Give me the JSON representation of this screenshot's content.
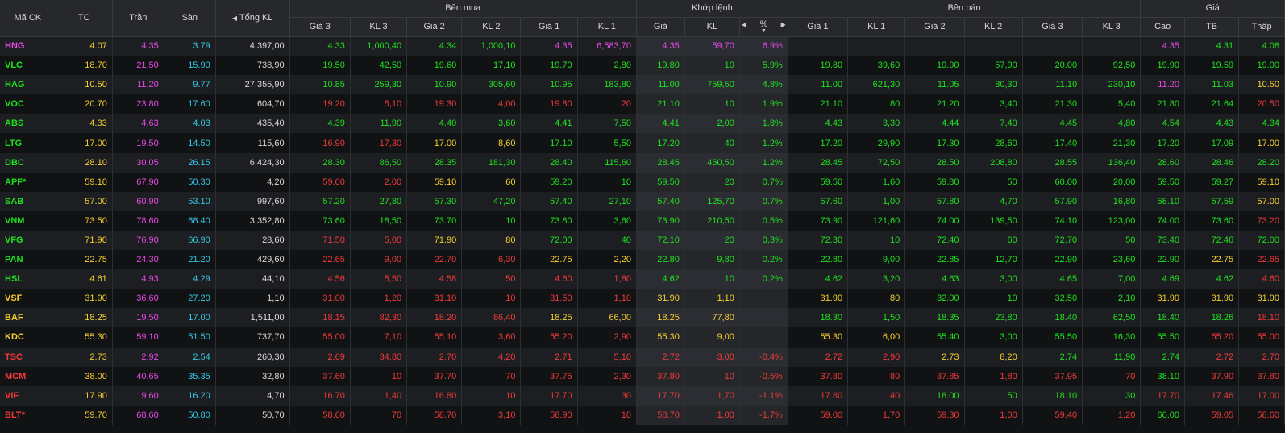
{
  "header": {
    "symbol": "Mã CK",
    "ref": "TC",
    "ceil": "Trần",
    "floor": "Sàn",
    "total": "Tổng KL",
    "buy_group": "Bên mua",
    "match_group": "Khớp lệnh",
    "sell_group": "Bên bán",
    "price_group": "Giá",
    "buy_cols": [
      "Giá 3",
      "KL 3",
      "Giá 2",
      "KL 2",
      "Giá 1",
      "KL 1"
    ],
    "match_cols": [
      "Giá",
      "KL",
      "%"
    ],
    "sell_cols": [
      "Giá 1",
      "KL 1",
      "Giá 2",
      "KL 2",
      "Giá 3",
      "KL 3"
    ],
    "price_cols": [
      "Cao",
      "TB",
      "Thấp"
    ],
    "arrow_left": "◀",
    "arrow_right": "▶",
    "sort_down": "▼"
  },
  "colors": {
    "up": "#1ee21e",
    "down": "#f23a3a",
    "ref": "#f5d030",
    "ceil": "#e44ae8",
    "floor": "#33c9e8",
    "neutral": "#d9d9d9"
  },
  "rows": [
    {
      "sym": "HNG",
      "sc": "ceil",
      "ref": "4.07",
      "ceil": "4.35",
      "floor": "3.79",
      "total": "4,397,00",
      "b3": [
        "4.33",
        "1,000,40",
        "up"
      ],
      "b2": [
        "4.34",
        "1,000,10",
        "up"
      ],
      "b1": [
        "4.35",
        "6,583,70",
        "ceil"
      ],
      "mp": [
        "4.35",
        "ceil"
      ],
      "mv": "59,70",
      "mpct": "6.9%",
      "s1": [
        "",
        "",
        ""
      ],
      "s2": [
        "",
        "",
        ""
      ],
      "s3": [
        "",
        "",
        ""
      ],
      "hi": [
        "4.35",
        "ceil"
      ],
      "avg": [
        "4.31",
        "up"
      ],
      "lo": [
        "4.08",
        "up"
      ]
    },
    {
      "sym": "VLC",
      "sc": "up",
      "ref": "18.70",
      "ceil": "21.50",
      "floor": "15.90",
      "total": "738,90",
      "b3": [
        "19.50",
        "42,50",
        "up"
      ],
      "b2": [
        "19.60",
        "17,10",
        "up"
      ],
      "b1": [
        "19.70",
        "2,80",
        "up"
      ],
      "mp": [
        "19.80",
        "up"
      ],
      "mv": "10",
      "mpct": "5.9%",
      "s1": [
        "19.80",
        "39,60",
        "up"
      ],
      "s2": [
        "19.90",
        "57,90",
        "up"
      ],
      "s3": [
        "20.00",
        "92,50",
        "up"
      ],
      "hi": [
        "19.90",
        "up"
      ],
      "avg": [
        "19.59",
        "up"
      ],
      "lo": [
        "19.00",
        "up"
      ]
    },
    {
      "sym": "HAG",
      "sc": "up",
      "ref": "10.50",
      "ceil": "11.20",
      "floor": "9.77",
      "total": "27,355,90",
      "b3": [
        "10.85",
        "259,30",
        "up"
      ],
      "b2": [
        "10.90",
        "305,60",
        "up"
      ],
      "b1": [
        "10.95",
        "183,80",
        "up"
      ],
      "mp": [
        "11.00",
        "up"
      ],
      "mv": "759,50",
      "mpct": "4.8%",
      "s1": [
        "11.00",
        "621,30",
        "up"
      ],
      "s2": [
        "11.05",
        "80,30",
        "up"
      ],
      "s3": [
        "11.10",
        "230,10",
        "up"
      ],
      "hi": [
        "11.20",
        "ceil"
      ],
      "avg": [
        "11.03",
        "up"
      ],
      "lo": [
        "10.50",
        "ref"
      ]
    },
    {
      "sym": "VOC",
      "sc": "up",
      "ref": "20.70",
      "ceil": "23.80",
      "floor": "17.60",
      "total": "604,70",
      "b3": [
        "19.20",
        "5,10",
        "down"
      ],
      "b2": [
        "19.30",
        "4,00",
        "down"
      ],
      "b1": [
        "19.80",
        "20",
        "down"
      ],
      "mp": [
        "21.10",
        "up"
      ],
      "mv": "10",
      "mpct": "1.9%",
      "s1": [
        "21.10",
        "80",
        "up"
      ],
      "s2": [
        "21.20",
        "3,40",
        "up"
      ],
      "s3": [
        "21.30",
        "5,40",
        "up"
      ],
      "hi": [
        "21.80",
        "up"
      ],
      "avg": [
        "21.64",
        "up"
      ],
      "lo": [
        "20.50",
        "down"
      ]
    },
    {
      "sym": "ABS",
      "sc": "up",
      "ref": "4.33",
      "ceil": "4.63",
      "floor": "4.03",
      "total": "435,40",
      "b3": [
        "4.39",
        "11,90",
        "up"
      ],
      "b2": [
        "4.40",
        "3,60",
        "up"
      ],
      "b1": [
        "4.41",
        "7,50",
        "up"
      ],
      "mp": [
        "4.41",
        "up"
      ],
      "mv": "2,00",
      "mpct": "1.8%",
      "s1": [
        "4.43",
        "3,30",
        "up"
      ],
      "s2": [
        "4.44",
        "7,40",
        "up"
      ],
      "s3": [
        "4.45",
        "4,80",
        "up"
      ],
      "hi": [
        "4.54",
        "up"
      ],
      "avg": [
        "4.43",
        "up"
      ],
      "lo": [
        "4.34",
        "up"
      ]
    },
    {
      "sym": "LTG",
      "sc": "up",
      "ref": "17.00",
      "ceil": "19.50",
      "floor": "14.50",
      "total": "115,60",
      "b3": [
        "16.90",
        "17,30",
        "down"
      ],
      "b2": [
        "17.00",
        "8,60",
        "ref"
      ],
      "b1": [
        "17.10",
        "5,50",
        "up"
      ],
      "mp": [
        "17.20",
        "up"
      ],
      "mv": "40",
      "mpct": "1.2%",
      "s1": [
        "17.20",
        "29,90",
        "up"
      ],
      "s2": [
        "17.30",
        "28,60",
        "up"
      ],
      "s3": [
        "17.40",
        "21,30",
        "up"
      ],
      "hi": [
        "17.20",
        "up"
      ],
      "avg": [
        "17.09",
        "up"
      ],
      "lo": [
        "17.00",
        "ref"
      ]
    },
    {
      "sym": "DBC",
      "sc": "up",
      "ref": "28.10",
      "ceil": "30.05",
      "floor": "26.15",
      "total": "6,424,30",
      "b3": [
        "28.30",
        "86,50",
        "up"
      ],
      "b2": [
        "28.35",
        "181,30",
        "up"
      ],
      "b1": [
        "28.40",
        "115,60",
        "up"
      ],
      "mp": [
        "28.45",
        "up"
      ],
      "mv": "450,50",
      "mpct": "1.2%",
      "s1": [
        "28.45",
        "72,50",
        "up"
      ],
      "s2": [
        "28.50",
        "208,80",
        "up"
      ],
      "s3": [
        "28.55",
        "136,40",
        "up"
      ],
      "hi": [
        "28.60",
        "up"
      ],
      "avg": [
        "28.46",
        "up"
      ],
      "lo": [
        "28.20",
        "up"
      ]
    },
    {
      "sym": "APF*",
      "sc": "up",
      "ref": "59.10",
      "ceil": "67.90",
      "floor": "50.30",
      "total": "4,20",
      "b3": [
        "59.00",
        "2,00",
        "down"
      ],
      "b2": [
        "59.10",
        "60",
        "ref"
      ],
      "b1": [
        "59.20",
        "10",
        "up"
      ],
      "mp": [
        "59.50",
        "up"
      ],
      "mv": "20",
      "mpct": "0.7%",
      "s1": [
        "59.50",
        "1,60",
        "up"
      ],
      "s2": [
        "59.80",
        "50",
        "up"
      ],
      "s3": [
        "60.00",
        "20,00",
        "up"
      ],
      "hi": [
        "59.50",
        "up"
      ],
      "avg": [
        "59.27",
        "up"
      ],
      "lo": [
        "59.10",
        "ref"
      ]
    },
    {
      "sym": "SAB",
      "sc": "up",
      "ref": "57.00",
      "ceil": "60.90",
      "floor": "53.10",
      "total": "997,60",
      "b3": [
        "57.20",
        "27,80",
        "up"
      ],
      "b2": [
        "57.30",
        "47,20",
        "up"
      ],
      "b1": [
        "57.40",
        "27,10",
        "up"
      ],
      "mp": [
        "57.40",
        "up"
      ],
      "mv": "125,70",
      "mpct": "0.7%",
      "s1": [
        "57.60",
        "1,00",
        "up"
      ],
      "s2": [
        "57.80",
        "4,70",
        "up"
      ],
      "s3": [
        "57.90",
        "16,80",
        "up"
      ],
      "hi": [
        "58.10",
        "up"
      ],
      "avg": [
        "57.59",
        "up"
      ],
      "lo": [
        "57.00",
        "ref"
      ]
    },
    {
      "sym": "VNM",
      "sc": "up",
      "ref": "73.50",
      "ceil": "78.60",
      "floor": "68.40",
      "total": "3,352,80",
      "b3": [
        "73.60",
        "18,50",
        "up"
      ],
      "b2": [
        "73.70",
        "10",
        "up"
      ],
      "b1": [
        "73.80",
        "3,60",
        "up"
      ],
      "mp": [
        "73.90",
        "up"
      ],
      "mv": "210,50",
      "mpct": "0.5%",
      "s1": [
        "73.90",
        "121,60",
        "up"
      ],
      "s2": [
        "74.00",
        "139,50",
        "up"
      ],
      "s3": [
        "74.10",
        "123,00",
        "up"
      ],
      "hi": [
        "74.00",
        "up"
      ],
      "avg": [
        "73.60",
        "up"
      ],
      "lo": [
        "73.20",
        "down"
      ]
    },
    {
      "sym": "VFG",
      "sc": "up",
      "ref": "71.90",
      "ceil": "76.90",
      "floor": "66.90",
      "total": "28,60",
      "b3": [
        "71.50",
        "5,00",
        "down"
      ],
      "b2": [
        "71.90",
        "80",
        "ref"
      ],
      "b1": [
        "72.00",
        "40",
        "up"
      ],
      "mp": [
        "72.10",
        "up"
      ],
      "mv": "20",
      "mpct": "0.3%",
      "s1": [
        "72.30",
        "10",
        "up"
      ],
      "s2": [
        "72.40",
        "60",
        "up"
      ],
      "s3": [
        "72.70",
        "50",
        "up"
      ],
      "hi": [
        "73.40",
        "up"
      ],
      "avg": [
        "72.46",
        "up"
      ],
      "lo": [
        "72.00",
        "up"
      ]
    },
    {
      "sym": "PAN",
      "sc": "up",
      "ref": "22.75",
      "ceil": "24.30",
      "floor": "21.20",
      "total": "429,60",
      "b3": [
        "22.65",
        "9,00",
        "down"
      ],
      "b2": [
        "22.70",
        "6,30",
        "down"
      ],
      "b1": [
        "22.75",
        "2,20",
        "ref"
      ],
      "mp": [
        "22.80",
        "up"
      ],
      "mv": "9,80",
      "mpct": "0.2%",
      "s1": [
        "22.80",
        "9,00",
        "up"
      ],
      "s2": [
        "22.85",
        "12,70",
        "up"
      ],
      "s3": [
        "22.90",
        "23,60",
        "up"
      ],
      "hi": [
        "22.90",
        "up"
      ],
      "avg": [
        "22.75",
        "ref"
      ],
      "lo": [
        "22.65",
        "down"
      ]
    },
    {
      "sym": "HSL",
      "sc": "up",
      "ref": "4.61",
      "ceil": "4.93",
      "floor": "4.29",
      "total": "44,10",
      "b3": [
        "4.56",
        "5,50",
        "down"
      ],
      "b2": [
        "4.58",
        "50",
        "down"
      ],
      "b1": [
        "4.60",
        "1,80",
        "down"
      ],
      "mp": [
        "4.62",
        "up"
      ],
      "mv": "10",
      "mpct": "0.2%",
      "s1": [
        "4.62",
        "3,20",
        "up"
      ],
      "s2": [
        "4.63",
        "3,00",
        "up"
      ],
      "s3": [
        "4.65",
        "7,00",
        "up"
      ],
      "hi": [
        "4.69",
        "up"
      ],
      "avg": [
        "4.62",
        "up"
      ],
      "lo": [
        "4.60",
        "down"
      ]
    },
    {
      "sym": "VSF",
      "sc": "ref",
      "ref": "31.90",
      "ceil": "36.60",
      "floor": "27.20",
      "total": "1,10",
      "b3": [
        "31.00",
        "1,20",
        "down"
      ],
      "b2": [
        "31.10",
        "10",
        "down"
      ],
      "b1": [
        "31.50",
        "1,10",
        "down"
      ],
      "mp": [
        "31.90",
        "ref"
      ],
      "mv": "1,10",
      "mpct": "",
      "s1": [
        "31.90",
        "80",
        "ref"
      ],
      "s2": [
        "32.00",
        "10",
        "up"
      ],
      "s3": [
        "32.50",
        "2,10",
        "up"
      ],
      "hi": [
        "31.90",
        "ref"
      ],
      "avg": [
        "31.90",
        "ref"
      ],
      "lo": [
        "31.90",
        "ref"
      ]
    },
    {
      "sym": "BAF",
      "sc": "ref",
      "ref": "18.25",
      "ceil": "19.50",
      "floor": "17.00",
      "total": "1,511,00",
      "b3": [
        "18.15",
        "82,30",
        "down"
      ],
      "b2": [
        "18.20",
        "86,40",
        "down"
      ],
      "b1": [
        "18.25",
        "66,00",
        "ref"
      ],
      "mp": [
        "18.25",
        "ref"
      ],
      "mv": "77,80",
      "mpct": "",
      "s1": [
        "18.30",
        "1,50",
        "up"
      ],
      "s2": [
        "18.35",
        "23,80",
        "up"
      ],
      "s3": [
        "18.40",
        "62,50",
        "up"
      ],
      "hi": [
        "18.40",
        "up"
      ],
      "avg": [
        "18.26",
        "up"
      ],
      "lo": [
        "18.10",
        "down"
      ]
    },
    {
      "sym": "KDC",
      "sc": "ref",
      "ref": "55.30",
      "ceil": "59.10",
      "floor": "51.50",
      "total": "737,70",
      "b3": [
        "55.00",
        "7,10",
        "down"
      ],
      "b2": [
        "55.10",
        "3,60",
        "down"
      ],
      "b1": [
        "55.20",
        "2,90",
        "down"
      ],
      "mp": [
        "55.30",
        "ref"
      ],
      "mv": "9,00",
      "mpct": "",
      "s1": [
        "55.30",
        "6,00",
        "ref"
      ],
      "s2": [
        "55.40",
        "3,00",
        "up"
      ],
      "s3": [
        "55.50",
        "16,30",
        "up"
      ],
      "hi": [
        "55.50",
        "up"
      ],
      "avg": [
        "55.20",
        "down"
      ],
      "lo": [
        "55.00",
        "down"
      ]
    },
    {
      "sym": "TSC",
      "sc": "down",
      "ref": "2.73",
      "ceil": "2.92",
      "floor": "2.54",
      "total": "260,30",
      "b3": [
        "2.69",
        "34,80",
        "down"
      ],
      "b2": [
        "2.70",
        "4,20",
        "down"
      ],
      "b1": [
        "2.71",
        "5,10",
        "down"
      ],
      "mp": [
        "2.72",
        "down"
      ],
      "mv": "3,00",
      "mpct": "-0.4%",
      "s1": [
        "2.72",
        "2,90",
        "down"
      ],
      "s2": [
        "2.73",
        "8,20",
        "ref"
      ],
      "s3": [
        "2.74",
        "11,90",
        "up"
      ],
      "hi": [
        "2.74",
        "up"
      ],
      "avg": [
        "2.72",
        "down"
      ],
      "lo": [
        "2.70",
        "down"
      ]
    },
    {
      "sym": "MCM",
      "sc": "down",
      "ref": "38.00",
      "ceil": "40.65",
      "floor": "35.35",
      "total": "32,80",
      "b3": [
        "37.60",
        "10",
        "down"
      ],
      "b2": [
        "37.70",
        "70",
        "down"
      ],
      "b1": [
        "37.75",
        "2,30",
        "down"
      ],
      "mp": [
        "37.80",
        "down"
      ],
      "mv": "10",
      "mpct": "-0.5%",
      "s1": [
        "37.80",
        "80",
        "down"
      ],
      "s2": [
        "37.85",
        "1,80",
        "down"
      ],
      "s3": [
        "37.95",
        "70",
        "down"
      ],
      "hi": [
        "38.10",
        "up"
      ],
      "avg": [
        "37.90",
        "down"
      ],
      "lo": [
        "37.80",
        "down"
      ]
    },
    {
      "sym": "VIF",
      "sc": "down",
      "ref": "17.90",
      "ceil": "19.60",
      "floor": "16.20",
      "total": "4,70",
      "b3": [
        "16.70",
        "1,40",
        "down"
      ],
      "b2": [
        "16.80",
        "10",
        "down"
      ],
      "b1": [
        "17.70",
        "30",
        "down"
      ],
      "mp": [
        "17.70",
        "down"
      ],
      "mv": "1,70",
      "mpct": "-1.1%",
      "s1": [
        "17.80",
        "40",
        "down"
      ],
      "s2": [
        "18.00",
        "50",
        "up"
      ],
      "s3": [
        "18.10",
        "30",
        "up"
      ],
      "hi": [
        "17.70",
        "down"
      ],
      "avg": [
        "17.46",
        "down"
      ],
      "lo": [
        "17.00",
        "down"
      ]
    },
    {
      "sym": "BLT*",
      "sc": "down",
      "ref": "59.70",
      "ceil": "68.60",
      "floor": "50.80",
      "total": "50,70",
      "b3": [
        "58.60",
        "70",
        "down"
      ],
      "b2": [
        "58.70",
        "3,10",
        "down"
      ],
      "b1": [
        "58.90",
        "10",
        "down"
      ],
      "mp": [
        "58.70",
        "down"
      ],
      "mv": "1,00",
      "mpct": "-1.7%",
      "s1": [
        "59.00",
        "1,70",
        "down"
      ],
      "s2": [
        "59.30",
        "1,00",
        "down"
      ],
      "s3": [
        "59.40",
        "1,20",
        "down"
      ],
      "hi": [
        "60.00",
        "up"
      ],
      "avg": [
        "59.05",
        "down"
      ],
      "lo": [
        "58.60",
        "down"
      ]
    }
  ]
}
